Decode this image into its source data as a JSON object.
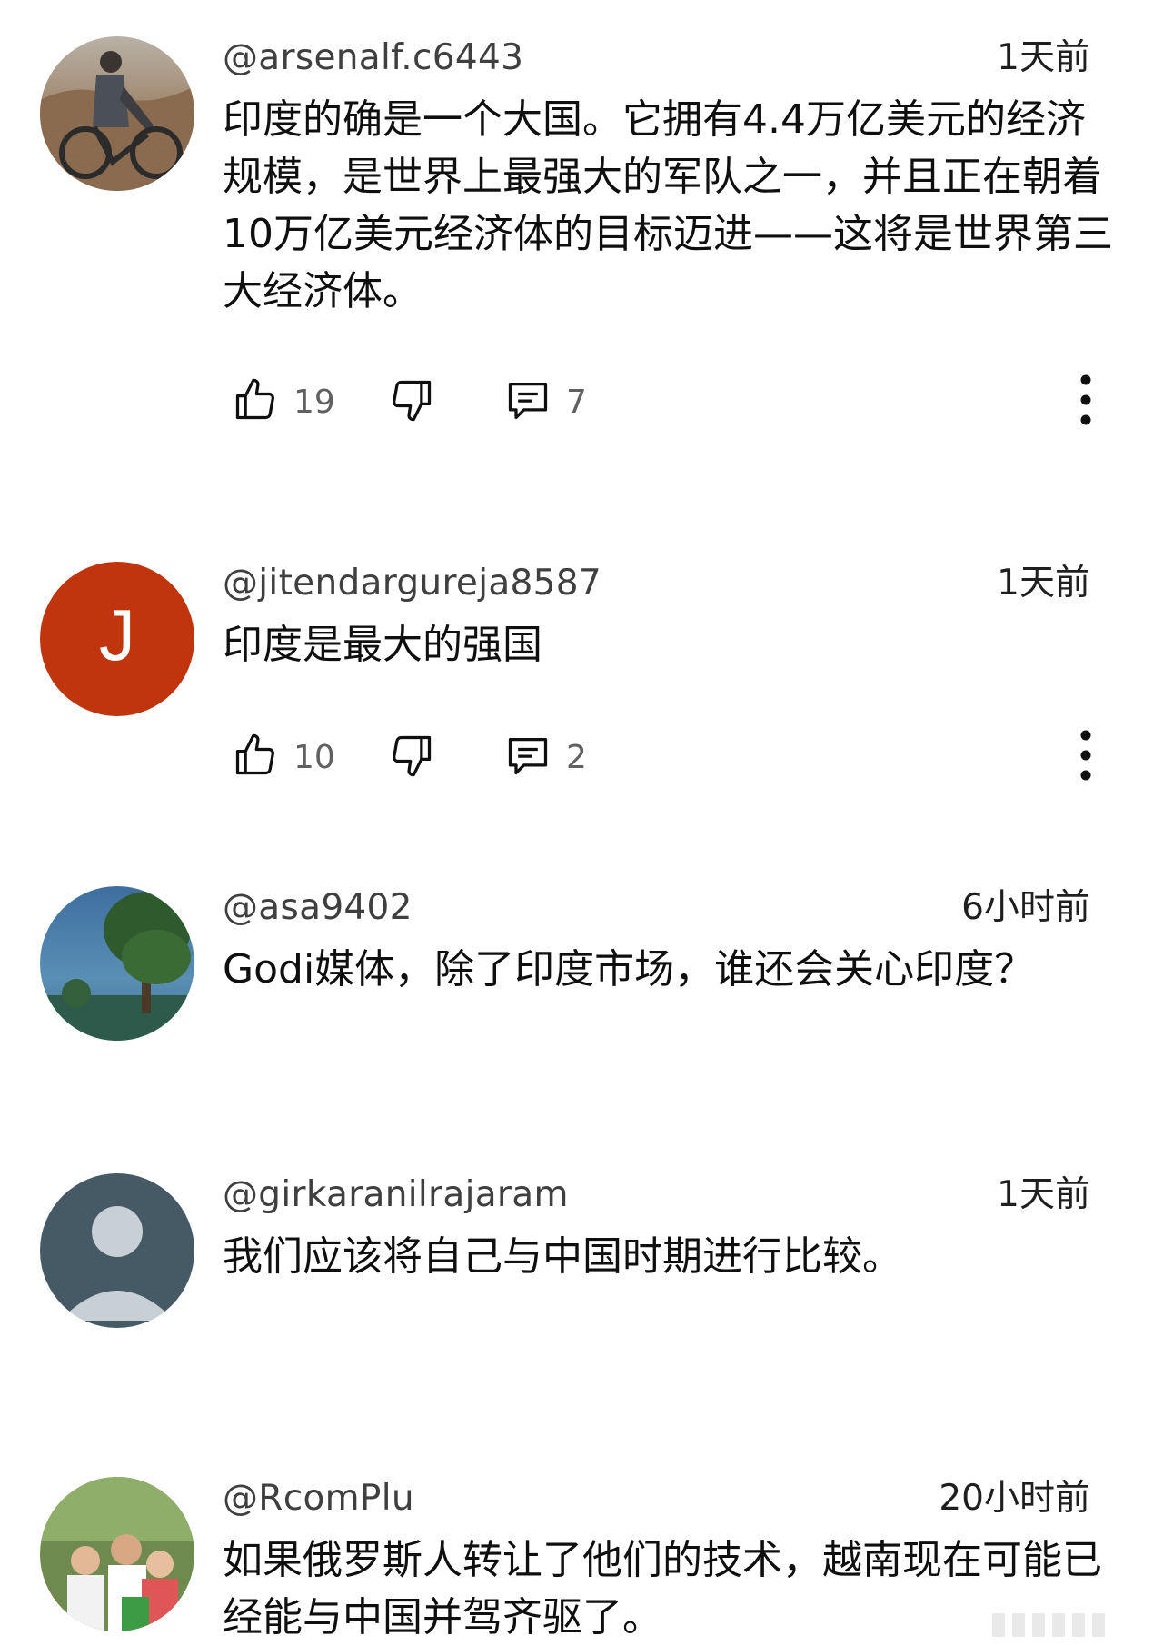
{
  "comments": [
    {
      "author": "@arsenalf.c6443",
      "time": "1天前",
      "text": "印度的确是一个大国。它拥有4.4万亿美元的经济规模，是世界上最强大的军队之一，并且正在朝着10万亿美元经济体的目标迈进——这将是世界第三大经济体。",
      "likes": "19",
      "replies": "7"
    },
    {
      "author": "@jitendargureja8587",
      "time": "1天前",
      "text": "印度是最大的强国",
      "avatar_letter": "J",
      "likes": "10",
      "replies": "2"
    },
    {
      "author": "@asa9402",
      "time": "6小时前",
      "text": "Godi媒体，除了印度市场，谁还会关心印度？"
    },
    {
      "author": "@girkaranilrajaram",
      "time": "1天前",
      "text": "我们应该将自己与中国时期进行比较。"
    },
    {
      "author": "@RcomPlu",
      "time": "20小时前",
      "text": "如果俄罗斯人转让了他们的技术，越南现在可能已经能与中国并驾齐驱了。"
    }
  ],
  "colors": {
    "avatar_j_bg": "#c1350e",
    "avatar_default_bg": "#455a64",
    "icon": "#0f0f0f",
    "meta_text": "#606060"
  },
  "icons": [
    "like-icon",
    "dislike-icon",
    "reply-icon",
    "more-vert-icon"
  ]
}
